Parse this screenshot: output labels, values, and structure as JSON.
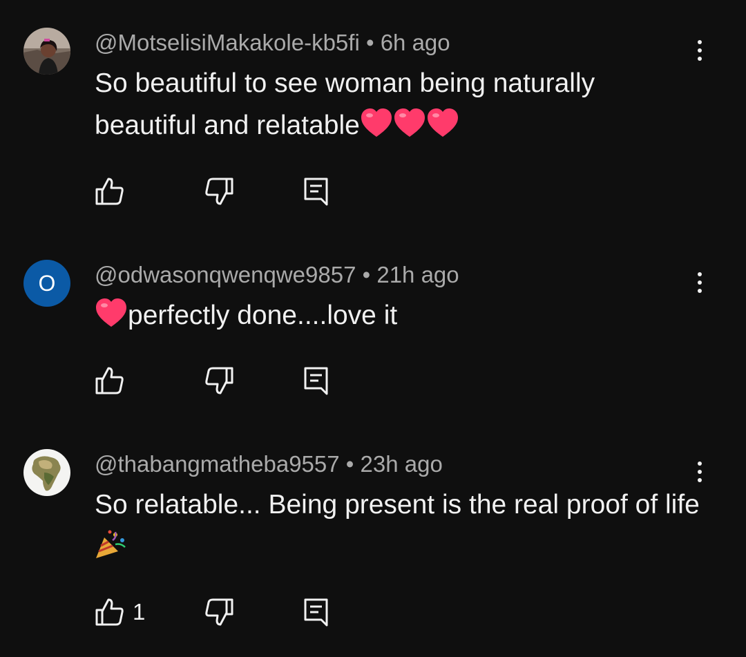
{
  "comments": [
    {
      "handle": "@MotselisiMakakole-kb5fi",
      "time": "6h ago",
      "avatar": "profile-photo",
      "text": "So beautiful to see woman being naturally beautiful and relatable",
      "emoji": [
        "red-heart-emoji",
        "red-heart-emoji",
        "red-heart-emoji"
      ],
      "likes": ""
    },
    {
      "handle": "@odwasonqwenqwe9857",
      "time": "21h ago",
      "avatar_letter": "O",
      "avatar_color": "#0b5aa6",
      "text": "perfectly done....love it",
      "emoji": [
        "red-heart-emoji"
      ],
      "likes": ""
    },
    {
      "handle": "@thabangmatheba9557",
      "time": "23h ago",
      "avatar": "africa-map-photo",
      "text": "So relatable... Being present is the real proof of life",
      "emoji": [
        "party-popper-emoji"
      ],
      "likes": "1"
    }
  ],
  "separator": "•",
  "colors": {
    "background": "#0f0f0f",
    "text": "#f1f1f1",
    "meta": "#aaaaaa",
    "heart": "#ff3b6b"
  }
}
